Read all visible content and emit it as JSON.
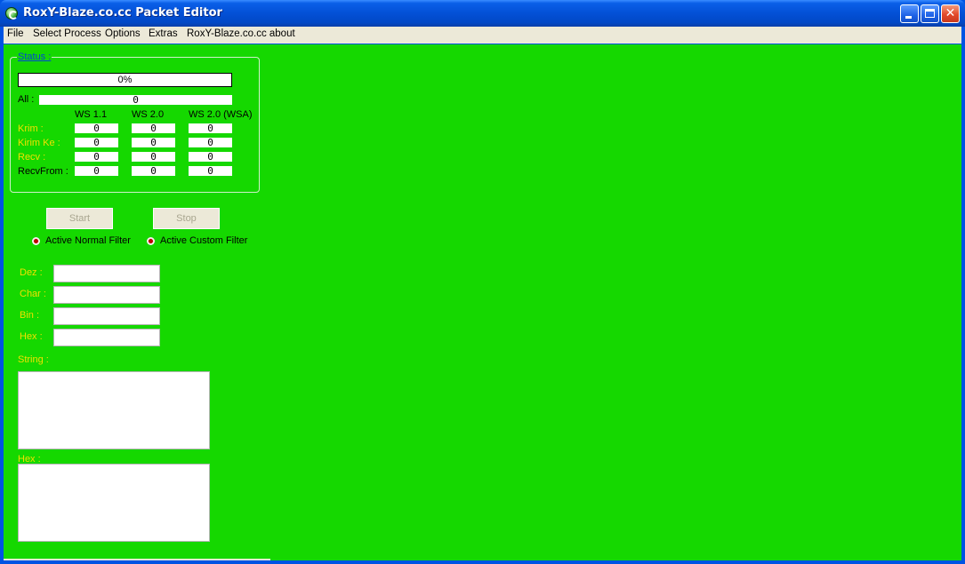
{
  "window": {
    "title": "RoxY-Blaze.co.cc Packet Editor",
    "bg_color": "#15d800"
  },
  "menu": [
    "File",
    "Select Process",
    "Options",
    "Extras",
    "RoxY-Blaze.co.cc about"
  ],
  "status": {
    "label": "Status :",
    "progress_text": "0%",
    "progress_value": 0,
    "all_label": "All :",
    "all_value": "0",
    "columns": [
      "WS 1.1",
      "WS 2.0",
      "WS 2.0 (WSA)"
    ],
    "rows": [
      {
        "label": "Krim :",
        "values": [
          "0",
          "0",
          "0"
        ]
      },
      {
        "label": "Kirim Ke :",
        "values": [
          "0",
          "0",
          "0"
        ]
      },
      {
        "label": "Recv :",
        "values": [
          "0",
          "0",
          "0"
        ]
      },
      {
        "label": "RecvFrom :",
        "values": [
          "0",
          "0",
          "0"
        ]
      }
    ]
  },
  "buttons": {
    "start": "Start",
    "stop": "Stop"
  },
  "filters": {
    "normal": "Active Normal Filter",
    "custom": "Active Custom Filter"
  },
  "converter": {
    "dez_label": "Dez :",
    "dez_value": "",
    "char_label": "Char :",
    "char_value": "",
    "bin_label": "Bin :",
    "bin_value": "",
    "hex_label": "Hex :",
    "hex_value": "",
    "string_label": "String :",
    "string_value": "",
    "hex_area_label": "Hex :",
    "hex_area_value": ""
  },
  "colors": {
    "label_yellow": "#f0e000",
    "link_blue": "#0046d5",
    "titlebar": "#0350d6"
  }
}
